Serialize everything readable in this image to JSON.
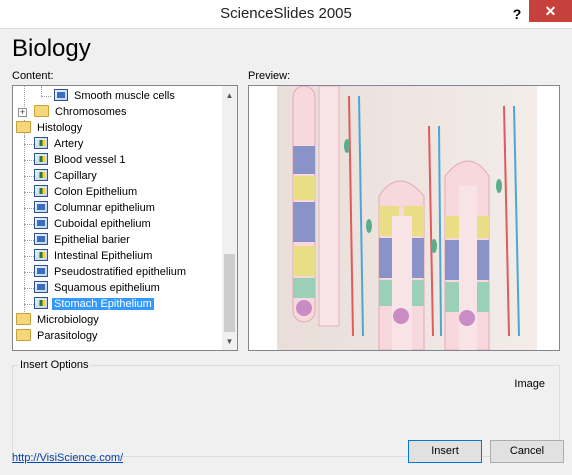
{
  "window": {
    "title": "ScienceSlides 2005",
    "help_label": "?",
    "close_label": "✕"
  },
  "heading": "Biology",
  "content_label": "Content:",
  "preview_label": "Preview:",
  "tree": [
    {
      "label": "Smooth muscle cells",
      "icon": "slide-icon"
    },
    {
      "label": "Chromosomes",
      "icon": "folder-icon"
    },
    {
      "label": "Histology",
      "icon": "folder-icon"
    },
    {
      "label": "Artery",
      "icon": "slide-image-icon"
    },
    {
      "label": "Blood vessel 1",
      "icon": "slide-image-icon"
    },
    {
      "label": "Capillary",
      "icon": "slide-image-icon"
    },
    {
      "label": "Colon Epithelium",
      "icon": "slide-image-icon"
    },
    {
      "label": "Columnar epithelium",
      "icon": "slide-icon"
    },
    {
      "label": "Cuboidal epithelium",
      "icon": "slide-icon"
    },
    {
      "label": "Epithelial barier",
      "icon": "slide-icon"
    },
    {
      "label": "Intestinal Epithelium",
      "icon": "slide-image-icon"
    },
    {
      "label": "Pseudostratified epithelium",
      "icon": "slide-icon"
    },
    {
      "label": "Squamous epithelium",
      "icon": "slide-icon"
    },
    {
      "label": "Stomach Epithelium",
      "icon": "slide-image-icon",
      "selected": true
    },
    {
      "label": "Microbiology",
      "icon": "folder-icon"
    },
    {
      "label": "Parasitology",
      "icon": "folder-icon"
    }
  ],
  "insert_options": {
    "legend": "Insert Options",
    "type_label": "Image"
  },
  "link": "http://VisiScience.com/",
  "buttons": {
    "insert": "Insert",
    "cancel": "Cancel"
  },
  "colors": {
    "selection": "#3399ff",
    "close": "#c7413c"
  }
}
